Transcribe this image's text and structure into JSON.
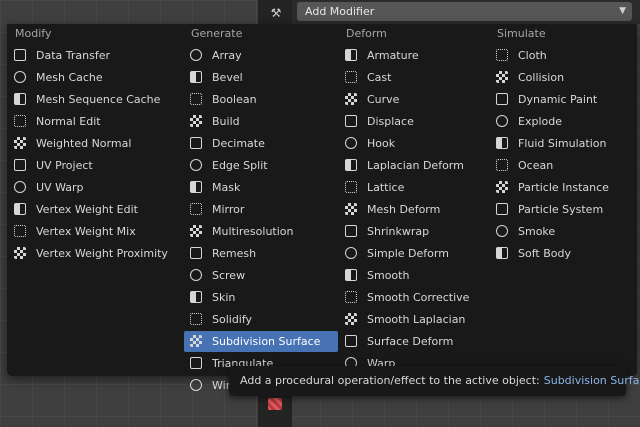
{
  "header": {
    "add_modifier_label": "Add Modifier"
  },
  "columns": [
    {
      "title": "Modify",
      "items": [
        "Data Transfer",
        "Mesh Cache",
        "Mesh Sequence Cache",
        "Normal Edit",
        "Weighted Normal",
        "UV Project",
        "UV Warp",
        "Vertex Weight Edit",
        "Vertex Weight Mix",
        "Vertex Weight Proximity"
      ]
    },
    {
      "title": "Generate",
      "items": [
        "Array",
        "Bevel",
        "Boolean",
        "Build",
        "Decimate",
        "Edge Split",
        "Mask",
        "Mirror",
        "Multiresolution",
        "Remesh",
        "Screw",
        "Skin",
        "Solidify",
        "Subdivision Surface",
        "Triangulate",
        "Wireframe"
      ]
    },
    {
      "title": "Deform",
      "items": [
        "Armature",
        "Cast",
        "Curve",
        "Displace",
        "Hook",
        "Laplacian Deform",
        "Lattice",
        "Mesh Deform",
        "Shrinkwrap",
        "Simple Deform",
        "Smooth",
        "Smooth Corrective",
        "Smooth Laplacian",
        "Surface Deform",
        "Warp"
      ]
    },
    {
      "title": "Simulate",
      "items": [
        "Cloth",
        "Collision",
        "Dynamic Paint",
        "Explode",
        "Fluid Simulation",
        "Ocean",
        "Particle Instance",
        "Particle System",
        "Smoke",
        "Soft Body"
      ]
    }
  ],
  "active_item": "Subdivision Surface",
  "tooltip": {
    "text": "Add a procedural operation/effect to the active object:",
    "target": "Subdivision Surface"
  },
  "colors": {
    "highlight": "#4772b3",
    "menu_bg": "#191919",
    "tooltip_target": "#8ab4e8"
  },
  "icons": {
    "tool_strip": "wrench-icon",
    "bottom_strip": "texture-icon"
  }
}
